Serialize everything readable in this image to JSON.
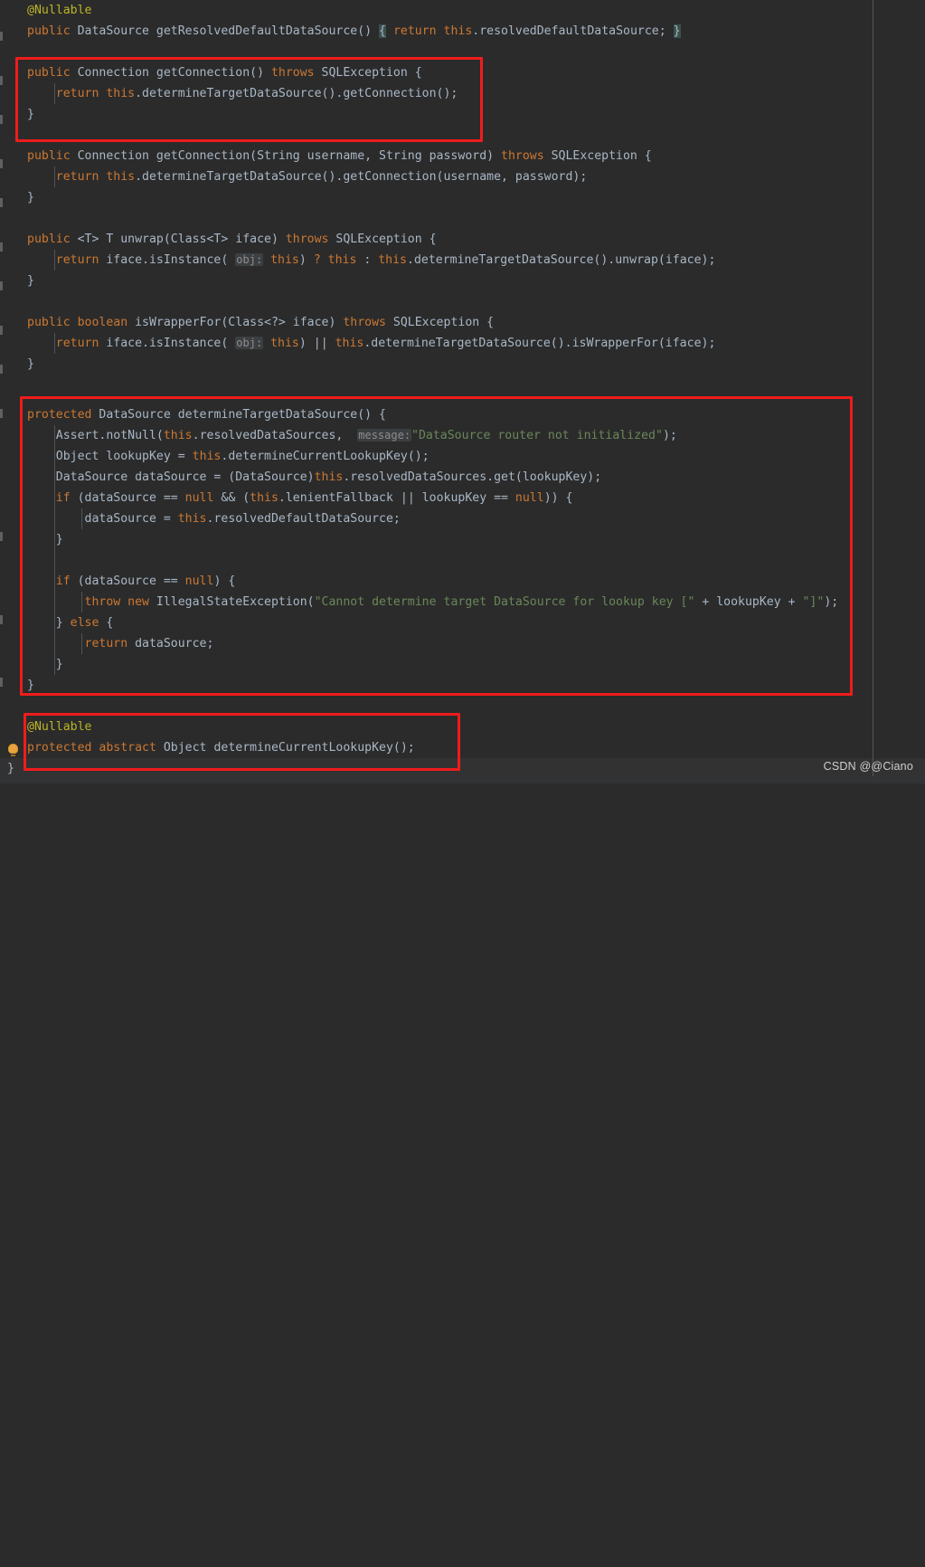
{
  "editor": {
    "theme_name": "darcula",
    "background_color": "#2b2b2b",
    "default_text_color": "#a9b7c6",
    "keyword_color": "#cc7832",
    "string_color": "#6a8759",
    "annotation_color": "#bbb529",
    "field_color": "#9876aa",
    "hint_bg_color": "#3c3f41",
    "highlight_color": "#ef1c1c",
    "language": "Java"
  },
  "watermark": {
    "text": "CSDN @@Ciano"
  },
  "gutter": {
    "bulb_icon": "lightbulb-icon",
    "fold_icon": "fold-marker-icon"
  },
  "annotations": {
    "boxes": [
      {
        "name": "getConnection-method-highlight"
      },
      {
        "name": "determineTargetDataSource-method-highlight"
      },
      {
        "name": "determineCurrentLookupKey-method-highlight"
      }
    ]
  },
  "code": {
    "lines": [
      {
        "id": "l1",
        "text": "    @Nullable"
      },
      {
        "id": "l2",
        "text": "    public DataSource getResolvedDefaultDataSource() { return this.resolvedDefaultDataSource; }"
      },
      {
        "id": "l3",
        "text": ""
      },
      {
        "id": "l4",
        "text": "    public Connection getConnection() throws SQLException {"
      },
      {
        "id": "l5",
        "text": "        return this.determineTargetDataSource().getConnection();"
      },
      {
        "id": "l6",
        "text": "    }"
      },
      {
        "id": "l7",
        "text": ""
      },
      {
        "id": "l8",
        "text": "    public Connection getConnection(String username, String password) throws SQLException {"
      },
      {
        "id": "l9",
        "text": "        return this.determineTargetDataSource().getConnection(username, password);"
      },
      {
        "id": "l10",
        "text": "    }"
      },
      {
        "id": "l11",
        "text": ""
      },
      {
        "id": "l12",
        "text": "    public <T> T unwrap(Class<T> iface) throws SQLException {"
      },
      {
        "id": "l13",
        "text": "        return iface.isInstance( obj: this) ? this : this.determineTargetDataSource().unwrap(iface);"
      },
      {
        "id": "l14",
        "text": "    }"
      },
      {
        "id": "l15",
        "text": ""
      },
      {
        "id": "l16",
        "text": "    public boolean isWrapperFor(Class<?> iface) throws SQLException {"
      },
      {
        "id": "l17",
        "text": "        return iface.isInstance( obj: this) || this.determineTargetDataSource().isWrapperFor(iface);"
      },
      {
        "id": "l18",
        "text": "    }"
      },
      {
        "id": "l19",
        "text": ""
      },
      {
        "id": "l20",
        "text": "    protected DataSource determineTargetDataSource() {"
      },
      {
        "id": "l21",
        "text": "        Assert.notNull(this.resolvedDataSources,  message: \"DataSource router not initialized\");"
      },
      {
        "id": "l22",
        "text": "        Object lookupKey = this.determineCurrentLookupKey();"
      },
      {
        "id": "l23",
        "text": "        DataSource dataSource = (DataSource)this.resolvedDataSources.get(lookupKey);"
      },
      {
        "id": "l24",
        "text": "        if (dataSource == null && (this.lenientFallback || lookupKey == null)) {"
      },
      {
        "id": "l25",
        "text": "            dataSource = this.resolvedDefaultDataSource;"
      },
      {
        "id": "l26",
        "text": "        }"
      },
      {
        "id": "l27",
        "text": ""
      },
      {
        "id": "l28",
        "text": "        if (dataSource == null) {"
      },
      {
        "id": "l29",
        "text": "            throw new IllegalStateException(\"Cannot determine target DataSource for lookup key [\" + lookupKey + \"]\");"
      },
      {
        "id": "l30",
        "text": "        } else {"
      },
      {
        "id": "l31",
        "text": "            return dataSource;"
      },
      {
        "id": "l32",
        "text": "        }"
      },
      {
        "id": "l33",
        "text": "    }"
      },
      {
        "id": "l34",
        "text": ""
      },
      {
        "id": "l35",
        "text": "    @Nullable"
      },
      {
        "id": "l36",
        "text": "    protected abstract Object determineCurrentLookupKey();"
      },
      {
        "id": "l37",
        "text": ""
      },
      {
        "id": "l38",
        "text": "}"
      }
    ],
    "inlay_hints": [
      {
        "id": "hint-obj-1",
        "text": "obj:"
      },
      {
        "id": "hint-obj-2",
        "text": "obj:"
      },
      {
        "id": "hint-message-1",
        "text": "message:"
      }
    ],
    "strings": [
      {
        "id": "str-router",
        "text": "\"DataSource router not initialized\""
      },
      {
        "id": "str-cannot",
        "text": "\"Cannot determine target DataSource for lookup key [\""
      },
      {
        "id": "str-bracket",
        "text": "\"]\""
      }
    ]
  }
}
